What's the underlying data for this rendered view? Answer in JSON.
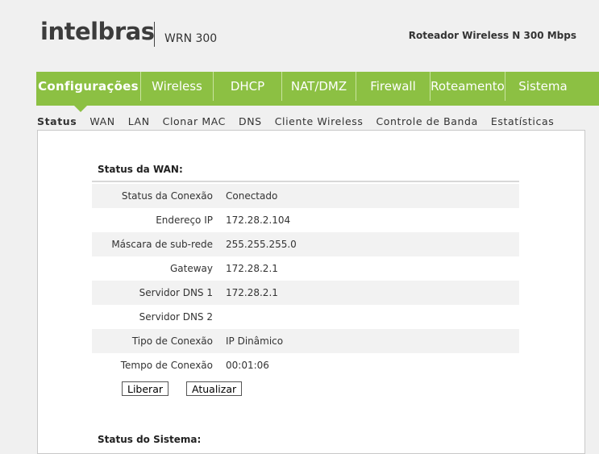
{
  "header": {
    "logo": "intelbras",
    "model": "WRN 300",
    "tagline": "Roteador Wireless N 300 Mbps"
  },
  "nav": [
    {
      "label": "Configurações",
      "active": true
    },
    {
      "label": "Wireless"
    },
    {
      "label": "DHCP"
    },
    {
      "label": "NAT/DMZ"
    },
    {
      "label": "Firewall"
    },
    {
      "label": "Roteamento"
    },
    {
      "label": "Sistema"
    }
  ],
  "subnav": [
    "Status",
    "WAN",
    "LAN",
    "Clonar MAC",
    "DNS",
    "Cliente Wireless",
    "Controle de Banda",
    "Estatísticas"
  ],
  "wan": {
    "title": "Status da WAN:",
    "rows": [
      {
        "label": "Status da Conexão",
        "value": "Conectado"
      },
      {
        "label": "Endereço IP",
        "value": "172.28.2.104"
      },
      {
        "label": "Máscara de sub-rede",
        "value": "255.255.255.0"
      },
      {
        "label": "Gateway",
        "value": "172.28.2.1"
      },
      {
        "label": "Servidor DNS 1",
        "value": "172.28.2.1"
      },
      {
        "label": "Servidor DNS 2",
        "value": ""
      },
      {
        "label": "Tipo de Conexão",
        "value": "IP Dinâmico"
      },
      {
        "label": "Tempo de Conexão",
        "value": "00:01:06"
      }
    ],
    "buttons": {
      "release": "Liberar",
      "refresh": "Atualizar"
    }
  },
  "system": {
    "title": "Status do Sistema:"
  }
}
